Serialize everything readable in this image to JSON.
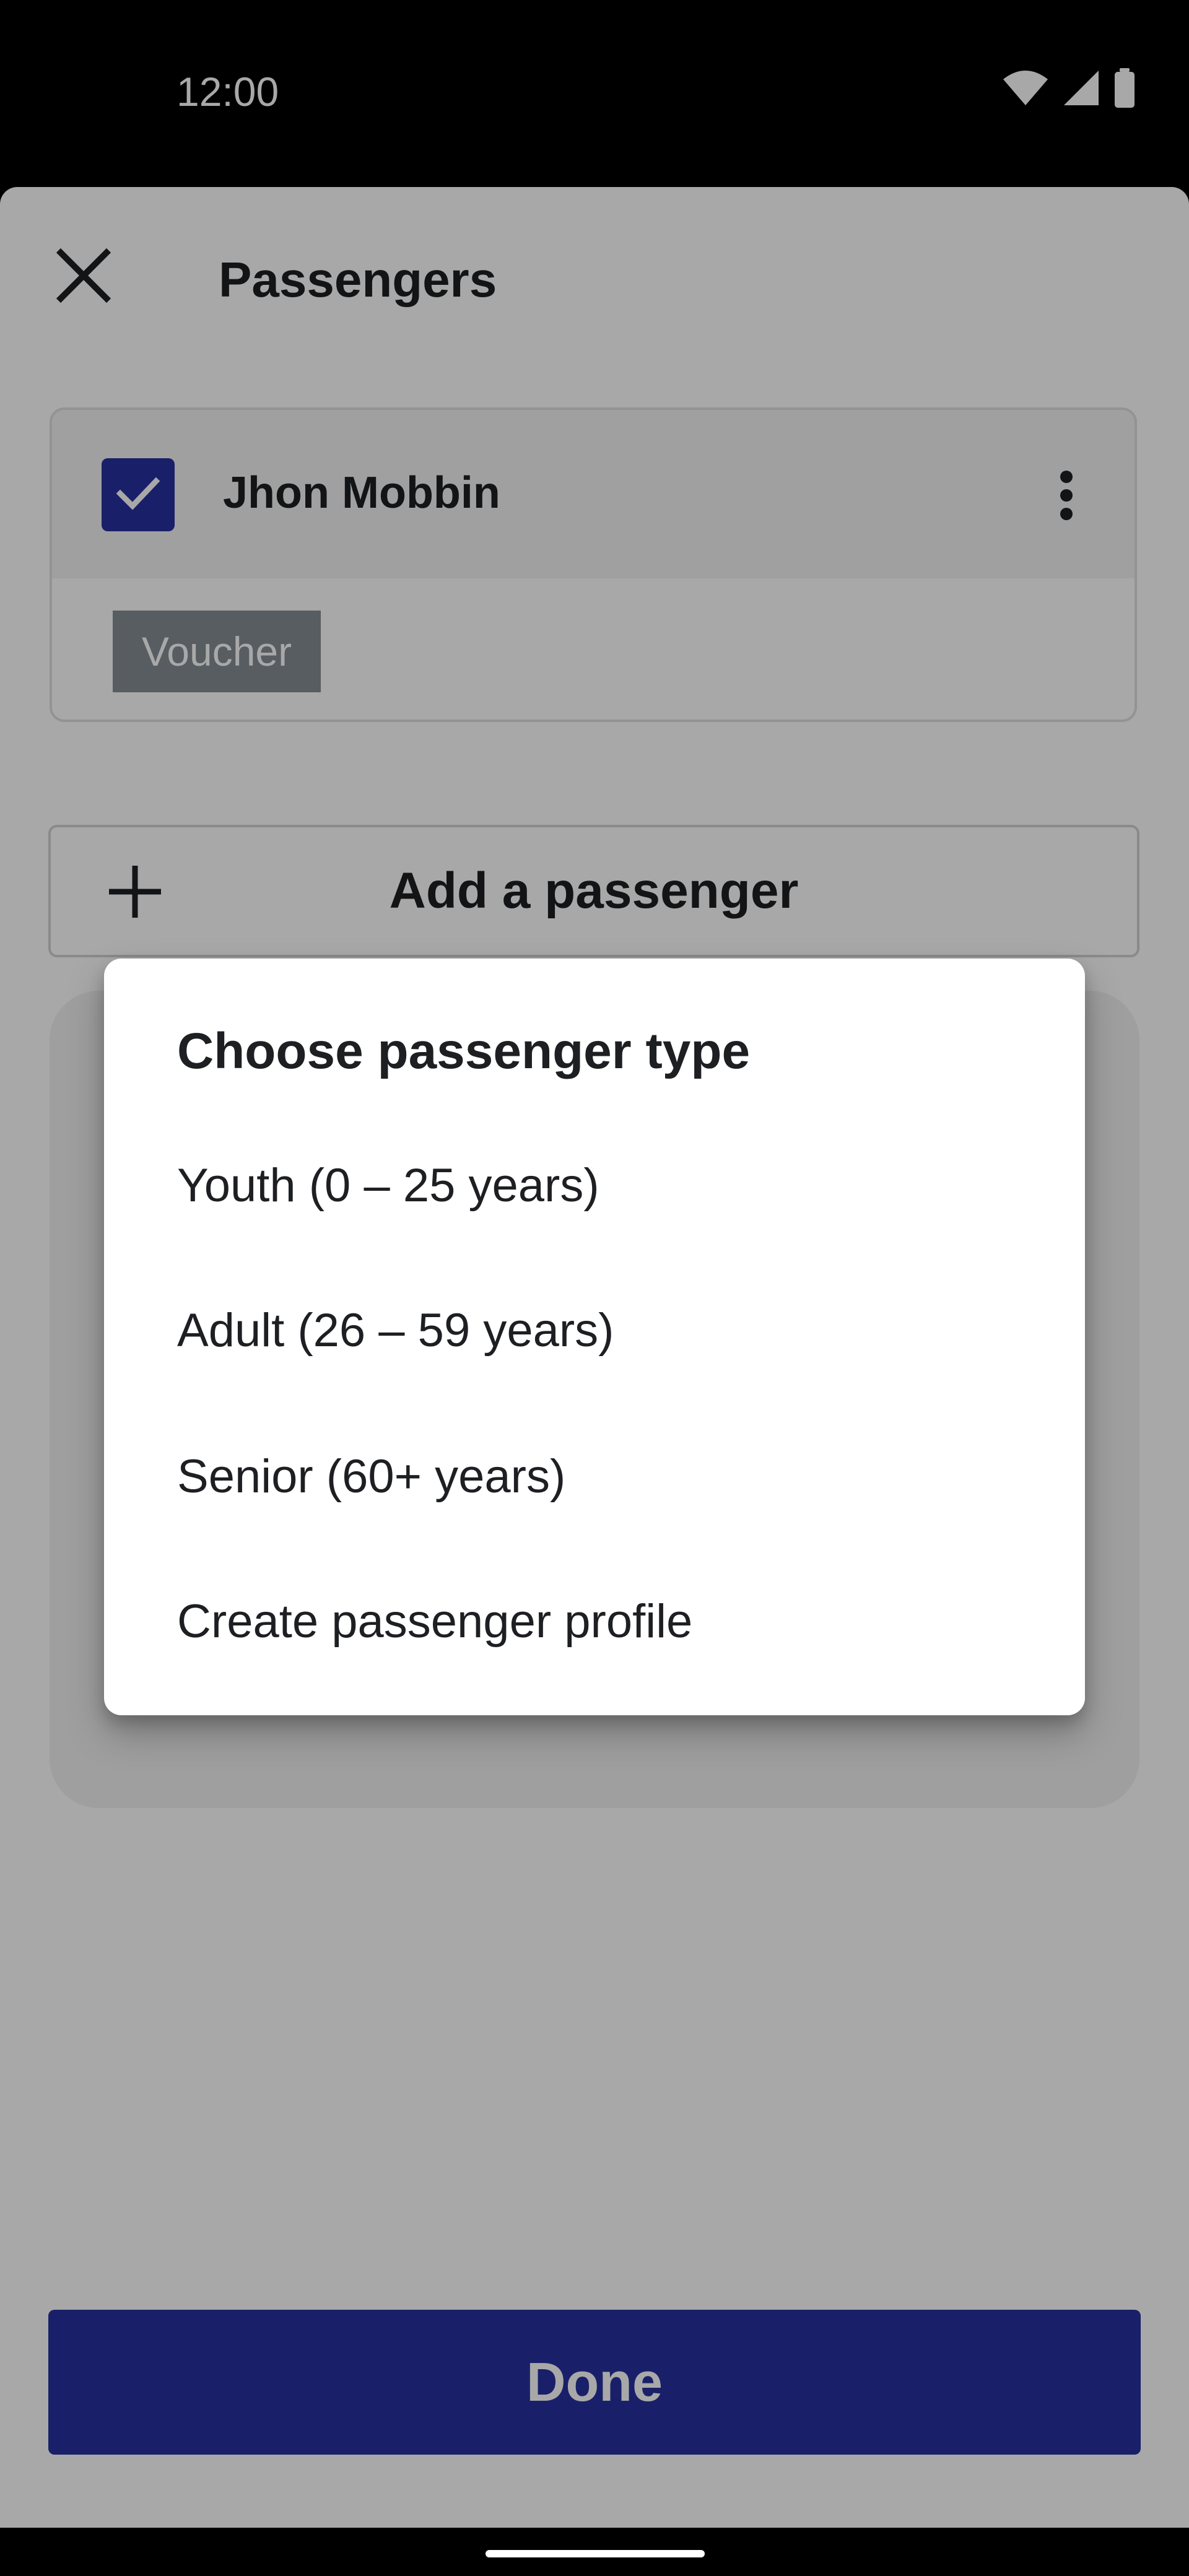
{
  "status_bar": {
    "time": "12:00",
    "icons": [
      "wifi-icon",
      "signal-icon",
      "battery-icon"
    ]
  },
  "header": {
    "title": "Passengers",
    "close_icon": "close-icon"
  },
  "passengers": [
    {
      "name": "Jhon Mobbin",
      "selected": true,
      "badge": "Voucher",
      "menu_icon": "more-vertical-icon"
    }
  ],
  "add_passenger": {
    "label": "Add a passenger",
    "icon": "plus-icon"
  },
  "dialog": {
    "title": "Choose passenger type",
    "options": [
      "Youth (0 – 25 years)",
      "Adult (26 – 59 years)",
      "Senior (60+ years)",
      "Create passenger profile"
    ]
  },
  "footer": {
    "done_label": "Done"
  },
  "colors": {
    "primary": "#2631a0",
    "badge": "#858d93",
    "text": "#1d1f22",
    "scrim": "rgba(0,0,0,0.34)"
  }
}
